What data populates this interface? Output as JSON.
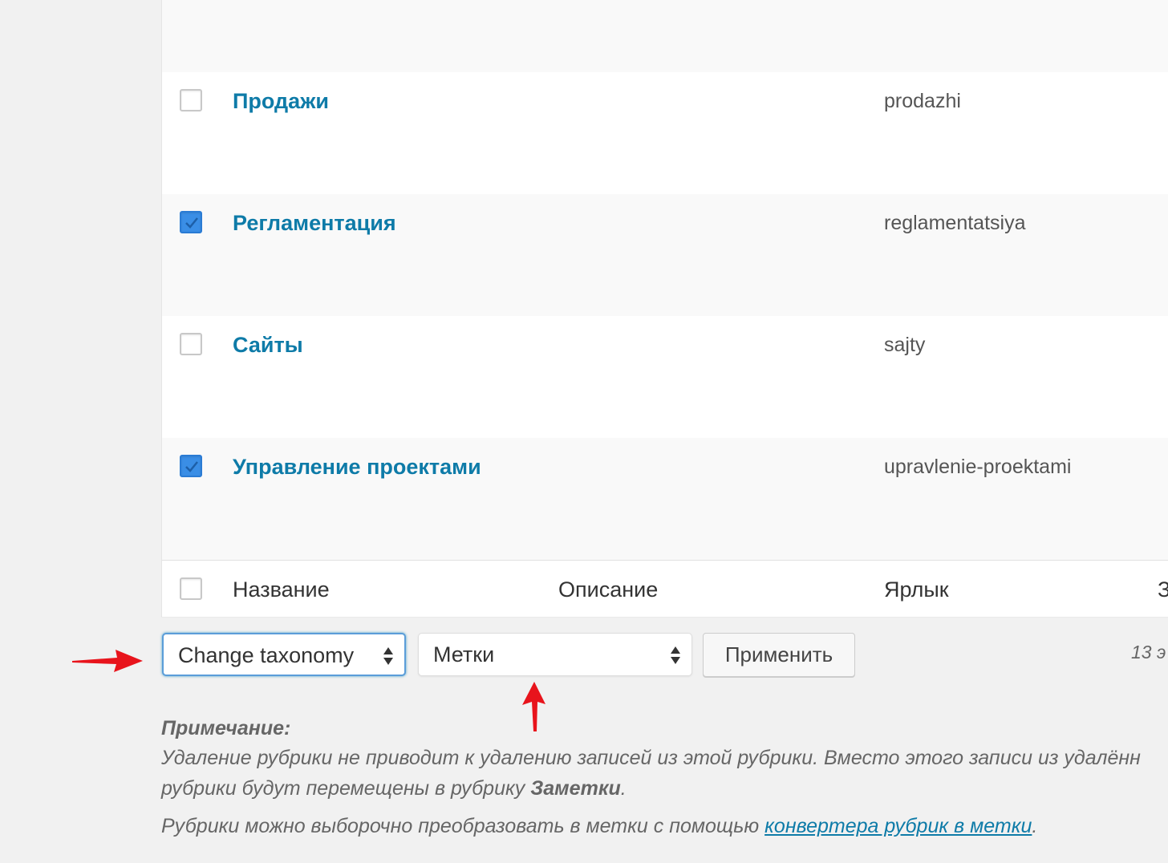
{
  "rows": [
    {
      "name": "Продажи",
      "slug": "prodazhi",
      "checked": false
    },
    {
      "name": "Регламентация",
      "slug": "reglamentatsiya",
      "checked": true
    },
    {
      "name": "Сайты",
      "slug": "sajty",
      "checked": false
    },
    {
      "name": "Управление проектами",
      "slug": "upravlenie-proektami",
      "checked": true
    }
  ],
  "footer": {
    "col_name": "Название",
    "col_description": "Описание",
    "col_slug": "Ярлык",
    "col_count_partial": "З"
  },
  "bulk": {
    "action_select": "Change taxonomy",
    "taxonomy_select": "Метки",
    "apply_label": "Применить",
    "count_partial": "13 э"
  },
  "note": {
    "heading": "Примечание:",
    "line1": "Удаление рубрики не приводит к удалению записей из этой рубрики. Вместо этого записи из удалённ",
    "line2_prefix": "рубрики будут перемещены в рубрику ",
    "line2_bold": "Заметки",
    "line2_suffix": ".",
    "line3_prefix": "Рубрики можно выборочно преобразовать в метки с помощью ",
    "line3_link": "конвертера рубрик в метки",
    "line3_suffix": "."
  },
  "colors": {
    "link": "#0e7ba8",
    "checkbox_checked": "#3a8ee6",
    "focus_border": "#5b9dd9",
    "annotation_arrow": "#e8141c"
  }
}
